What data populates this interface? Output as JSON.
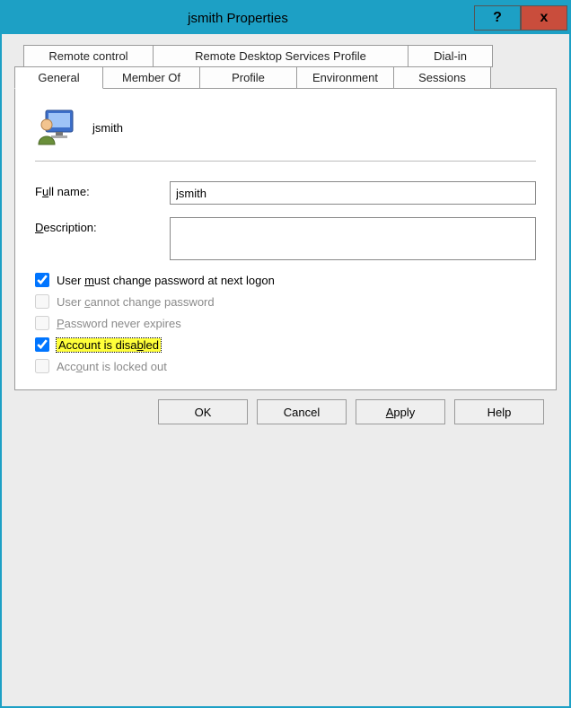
{
  "window": {
    "title": "jsmith Properties"
  },
  "titlebar": {
    "help": "?",
    "close": "x"
  },
  "tabs": {
    "top": {
      "remote_control": "Remote control",
      "rdsp": "Remote Desktop Services Profile",
      "dialin": "Dial-in"
    },
    "bottom": {
      "general": "General",
      "member_of": "Member Of",
      "profile": "Profile",
      "environment": "Environment",
      "sessions": "Sessions"
    }
  },
  "general": {
    "user_display": "jsmith",
    "fullname_label_pre": "F",
    "fullname_label_ul": "u",
    "fullname_label_post": "ll name:",
    "fullname_value": "jsmith",
    "description_label_ul": "D",
    "description_label_post": "escription:",
    "description_value": "",
    "checks": {
      "must_change": {
        "pre": "User ",
        "ul": "m",
        "post": "ust change password at next logon",
        "checked": true,
        "enabled": true,
        "highlight": false
      },
      "cannot_change": {
        "pre": "User ",
        "ul": "c",
        "post": "annot change password",
        "checked": false,
        "enabled": false,
        "highlight": false
      },
      "never_expires": {
        "pre": "",
        "ul": "P",
        "post": "assword never expires",
        "checked": false,
        "enabled": false,
        "highlight": false
      },
      "acct_disabled": {
        "pre": "Account is disa",
        "ul": "b",
        "post": "led",
        "checked": true,
        "enabled": true,
        "highlight": true
      },
      "locked_out": {
        "pre": "Acc",
        "ul": "o",
        "post": "unt is locked out",
        "checked": false,
        "enabled": false,
        "highlight": false
      }
    }
  },
  "buttons": {
    "ok": "OK",
    "cancel": "Cancel",
    "apply": "Apply",
    "help": "Help"
  },
  "apply_underline": "A",
  "apply_post": "pply"
}
